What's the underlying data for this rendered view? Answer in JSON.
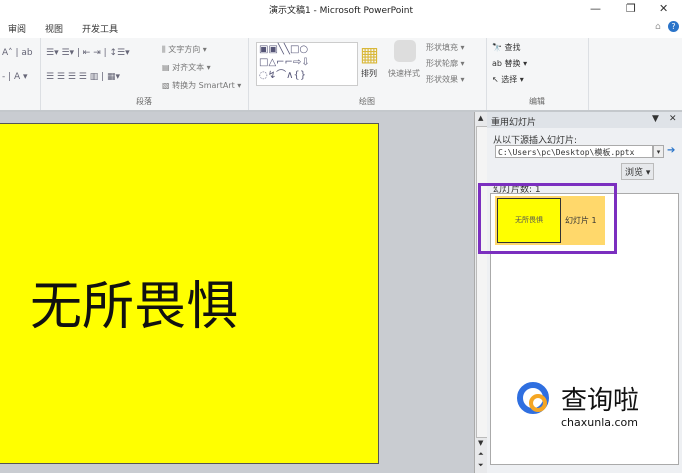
{
  "window": {
    "title": "演示文稿1 - Microsoft PowerPoint",
    "minimize": "—",
    "restore": "❐",
    "close": "✕",
    "help": "?"
  },
  "tabs": [
    "审阅",
    "视图",
    "开发工具"
  ],
  "ribbon": {
    "paragraph": {
      "label": "段落",
      "text_direction": "文字方向 ▾",
      "align_text": "对齐文本 ▾",
      "smartart": "转换为 SmartArt ▾"
    },
    "drawing": {
      "label": "绘图",
      "arrange": "排列",
      "quick_styles": "快速样式",
      "shape_fill": "形状填充 ▾",
      "shape_outline": "形状轮廓 ▾",
      "shape_effects": "形状效果 ▾"
    },
    "editing": {
      "label": "编辑",
      "find": "查找",
      "replace": "替换 ▾",
      "select": "选择 ▾"
    }
  },
  "slide": {
    "text": "无所畏惧",
    "background": "#ffff00"
  },
  "pane": {
    "title": "重用幻灯片",
    "source_label": "从以下源插入幻灯片:",
    "path": "C:\\Users\\pc\\Desktop\\模板.pptx",
    "browse": "浏览 ▾",
    "count_label": "幻灯片数: 1",
    "slides": [
      {
        "thumb_text": "无所畏惧",
        "label": "幻灯片 1"
      }
    ]
  },
  "watermark": {
    "name": "查询啦",
    "domain": "chaxunla.com"
  },
  "colors": {
    "highlight": "#7b2fbf",
    "selected_item": "#ffd86b"
  }
}
